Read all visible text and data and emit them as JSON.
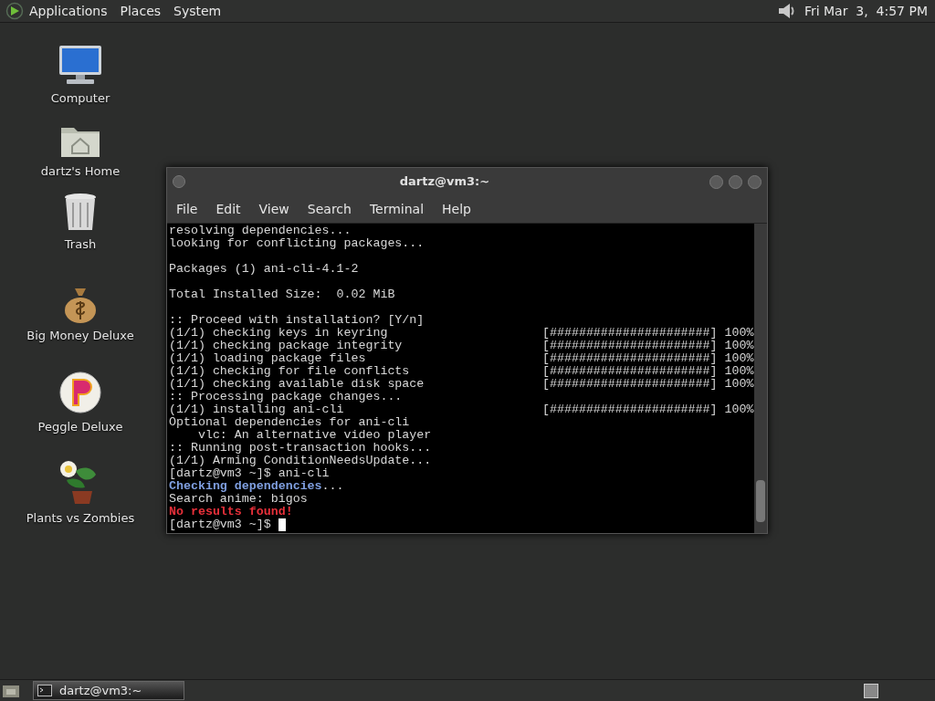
{
  "top_panel": {
    "menus": [
      "Applications",
      "Places",
      "System"
    ],
    "clock": "Fri Mar  3,  4:57 PM"
  },
  "desktop_icons": [
    {
      "label": "Computer",
      "kind": "computer"
    },
    {
      "label": "dartz's Home",
      "kind": "home"
    },
    {
      "label": "Trash",
      "kind": "trash"
    },
    {
      "label": "Big Money Deluxe",
      "kind": "money"
    },
    {
      "label": "Peggle Deluxe",
      "kind": "peggle"
    },
    {
      "label": "Plants vs Zombies",
      "kind": "plants"
    }
  ],
  "terminal": {
    "title": "dartz@vm3:~",
    "menu": [
      "File",
      "Edit",
      "View",
      "Search",
      "Terminal",
      "Help"
    ],
    "lines": [
      {
        "kind": "plain",
        "text": "resolving dependencies..."
      },
      {
        "kind": "plain",
        "text": "looking for conflicting packages..."
      },
      {
        "kind": "blank"
      },
      {
        "kind": "plain",
        "text": "Packages (1) ani-cli-4.1-2"
      },
      {
        "kind": "blank"
      },
      {
        "kind": "plain",
        "text": "Total Installed Size:  0.02 MiB"
      },
      {
        "kind": "blank"
      },
      {
        "kind": "plain",
        "text": ":: Proceed with installation? [Y/n]"
      },
      {
        "kind": "progress",
        "text": "(1/1) checking keys in keyring",
        "bar": "[######################]",
        "percent": "100%"
      },
      {
        "kind": "progress",
        "text": "(1/1) checking package integrity",
        "bar": "[######################]",
        "percent": "100%"
      },
      {
        "kind": "progress",
        "text": "(1/1) loading package files",
        "bar": "[######################]",
        "percent": "100%"
      },
      {
        "kind": "progress",
        "text": "(1/1) checking for file conflicts",
        "bar": "[######################]",
        "percent": "100%"
      },
      {
        "kind": "progress",
        "text": "(1/1) checking available disk space",
        "bar": "[######################]",
        "percent": "100%"
      },
      {
        "kind": "plain",
        "text": ":: Processing package changes..."
      },
      {
        "kind": "progress",
        "text": "(1/1) installing ani-cli",
        "bar": "[######################]",
        "percent": "100%"
      },
      {
        "kind": "plain",
        "text": "Optional dependencies for ani-cli"
      },
      {
        "kind": "plain",
        "text": "    vlc: An alternative video player"
      },
      {
        "kind": "plain",
        "text": ":: Running post-transaction hooks..."
      },
      {
        "kind": "plain",
        "text": "(1/1) Arming ConditionNeedsUpdate..."
      },
      {
        "kind": "plain",
        "text": "[dartz@vm3 ~]$ ani-cli"
      },
      {
        "kind": "info",
        "text": "Checking dependencies",
        "suffix": "..."
      },
      {
        "kind": "plain",
        "text": "Search anime: bigos"
      },
      {
        "kind": "error",
        "text": "No results found!"
      },
      {
        "kind": "prompt",
        "text": "[dartz@vm3 ~]$ "
      }
    ]
  },
  "taskbar": {
    "windows": [
      {
        "label": "dartz@vm3:~",
        "selected": true
      }
    ]
  }
}
